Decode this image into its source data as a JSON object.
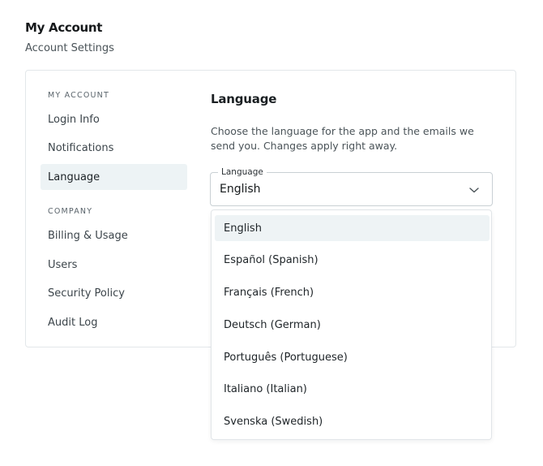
{
  "header": {
    "title": "My Account",
    "subtitle": "Account Settings"
  },
  "sidebar": {
    "sections": [
      {
        "label": "MY ACCOUNT",
        "items": [
          {
            "label": "Login Info"
          },
          {
            "label": "Notifications"
          },
          {
            "label": "Language",
            "active": true
          }
        ]
      },
      {
        "label": "COMPANY",
        "items": [
          {
            "label": "Billing & Usage"
          },
          {
            "label": "Users"
          },
          {
            "label": "Security Policy"
          },
          {
            "label": "Audit Log"
          }
        ]
      }
    ]
  },
  "main": {
    "heading": "Language",
    "description": "Choose the language for the app and the emails we send you. Changes apply right away.",
    "language_select": {
      "label": "Language",
      "value": "English",
      "icon": "chevron-down-icon",
      "options": [
        {
          "label": "English",
          "selected": true
        },
        {
          "label": "Español (Spanish)"
        },
        {
          "label": "Français (French)"
        },
        {
          "label": "Deutsch (German)"
        },
        {
          "label": "Português (Portuguese)"
        },
        {
          "label": "Italiano (Italian)"
        },
        {
          "label": "Svenska (Swedish)"
        }
      ]
    }
  },
  "colors": {
    "active_item_bg": "#edf3f5",
    "selected_option_bg": "#eef3f5",
    "border": "#e3e7ea"
  }
}
